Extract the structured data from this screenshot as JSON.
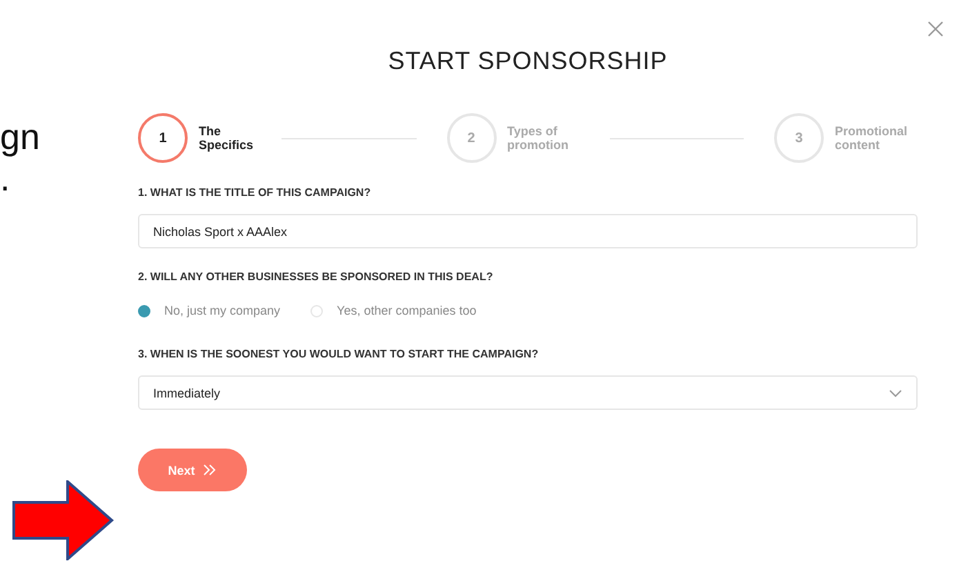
{
  "background_text": [
    "gn",
    "."
  ],
  "title": "START SPONSORSHIP",
  "steps": [
    {
      "number": "1",
      "label": "The Specifics",
      "selected": true
    },
    {
      "number": "2",
      "label": "Types of promotion",
      "selected": false
    },
    {
      "number": "3",
      "label": "Promotional content",
      "selected": false
    }
  ],
  "questions": [
    {
      "kind": "text",
      "label": "1. WHAT IS THE TITLE OF THIS CAMPAIGN?",
      "value": "Nicholas Sport x AAAlex"
    },
    {
      "kind": "radio",
      "label": "2. WILL ANY OTHER BUSINESSES BE SPONSORED IN THIS DEAL?",
      "options": [
        {
          "label": "No, just my company",
          "selected": true
        },
        {
          "label": "Yes, other companies too",
          "selected": false
        }
      ]
    },
    {
      "kind": "select",
      "label": "3. WHEN IS THE SOONEST YOU WOULD WANT TO START THE CAMPAIGN?",
      "value": "Immediately"
    }
  ],
  "next_button": "Next"
}
